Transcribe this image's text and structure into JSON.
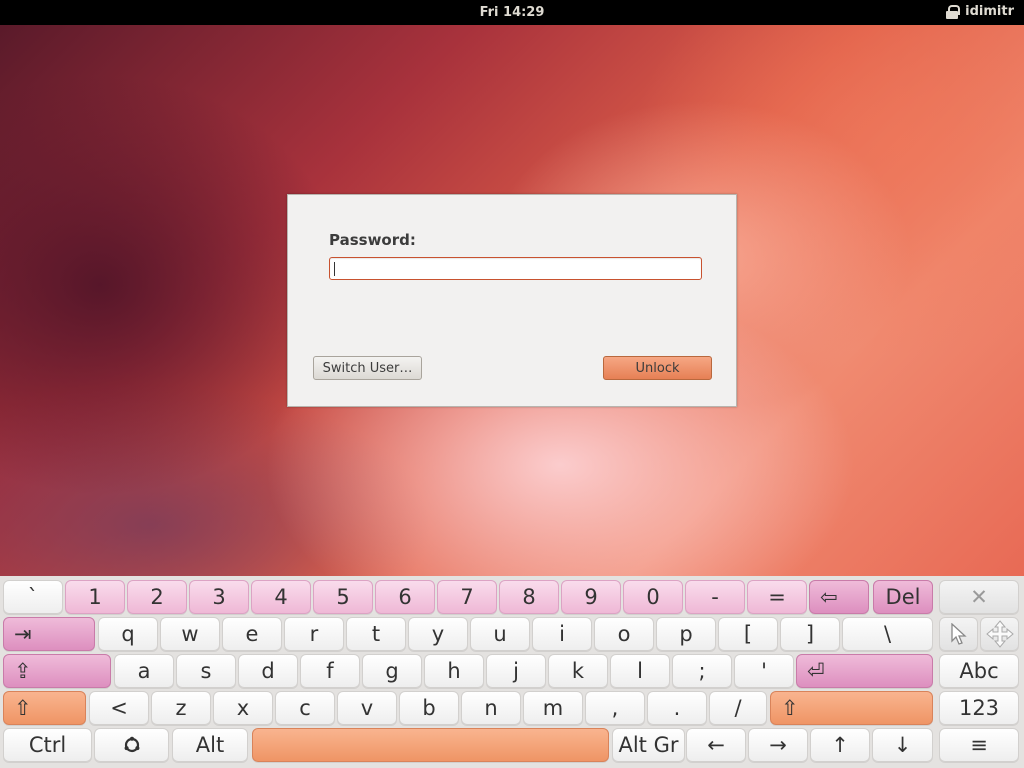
{
  "top_panel": {
    "clock": "Fri 14:29",
    "user": "idimitr",
    "lock_icon": "lock-icon"
  },
  "dialog": {
    "password_label": "Password:",
    "password_value": "",
    "switch_user": "Switch User…",
    "unlock": "Unlock"
  },
  "keyboard": {
    "row1": [
      "`",
      "1",
      "2",
      "3",
      "4",
      "5",
      "6",
      "7",
      "8",
      "9",
      "0",
      "-",
      "=",
      "⇦",
      "Del"
    ],
    "row1_close": "✕",
    "row2": [
      "⇥",
      "q",
      "w",
      "e",
      "r",
      "t",
      "y",
      "u",
      "i",
      "o",
      "p",
      "[",
      "]",
      "\\"
    ],
    "row2_pointer": "pointer-icon",
    "row2_move": "move-icon",
    "row3": [
      "⇪",
      "a",
      "s",
      "d",
      "f",
      "g",
      "h",
      "j",
      "k",
      "l",
      ";",
      "'",
      "⏎"
    ],
    "row3_abc": "Abc",
    "row4": [
      "⇧",
      "<",
      "z",
      "x",
      "c",
      "v",
      "b",
      "n",
      "m",
      ",",
      ".",
      "/",
      "⇧"
    ],
    "row4_123": "123",
    "row5": [
      "Ctrl",
      "⎈",
      "Alt",
      "",
      "Alt Gr",
      "←",
      "→",
      "↑",
      "↓"
    ],
    "row5_menu": "≡"
  }
}
